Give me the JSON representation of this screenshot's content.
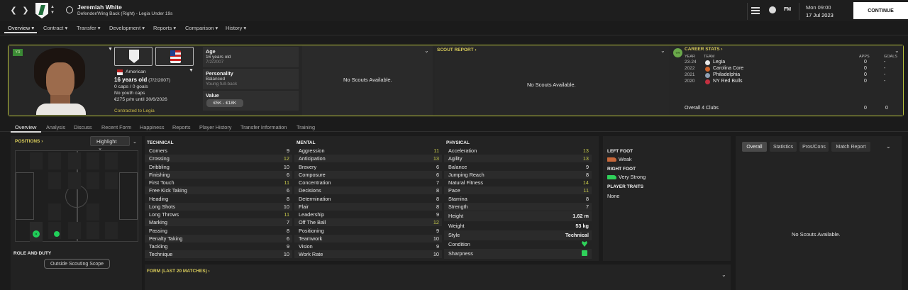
{
  "header": {
    "player_name": "Jeremiah White",
    "player_subtitle": "Defender/Wing Back (Right) - Legia Under 19s",
    "fm_logo": "FM",
    "date_day": "Mon 09:00",
    "date_full": "17 Jul 2023",
    "continue_label": "CONTINUE",
    "back_icon": "chevron-left-icon",
    "forward_icon": "chevron-right-icon"
  },
  "nav": {
    "items": [
      "Overview",
      "Contract",
      "Transfer",
      "Development",
      "Reports",
      "Comparison",
      "History"
    ]
  },
  "profile": {
    "badge": "YR",
    "nationality": "American",
    "age_line": "16 years old",
    "dob_short": "(7/2/2007)",
    "caps": "0 caps / 0 goals",
    "youth_caps": "No youth caps",
    "wage": "€275 p/m until 30/6/2026",
    "contract_status": "Contracted to Legia",
    "age_label": "Age",
    "age_value": "16 years old",
    "age_dob": "7/2/2007",
    "personality_label": "Personality",
    "personality_value": "Balanced",
    "personality_sub": "Young full-back",
    "value_label": "Value",
    "value_range": "€5K - €18K",
    "no_scouts_1": "No Scouts Available.",
    "scout_report_label": "SCOUT REPORT",
    "no_scouts_2": "No Scouts Available.",
    "career_badge": "YR",
    "career_label": "CAREER STATS",
    "career_headers": {
      "year": "YEAR",
      "team": "TEAM",
      "apps": "APPS",
      "goals": "GOALS"
    },
    "career_rows": [
      {
        "year": "23-24",
        "team": "Legia",
        "apps": "0",
        "goals": "-"
      },
      {
        "year": "2022",
        "team": "Carolina Core",
        "apps": "0",
        "goals": "-"
      },
      {
        "year": "2021",
        "team": "Philadelphia",
        "apps": "0",
        "goals": "-"
      },
      {
        "year": "2020",
        "team": "NY Red Bulls",
        "apps": "0",
        "goals": "-"
      }
    ],
    "career_total": {
      "label": "Overall 4 Clubs",
      "apps": "0",
      "goals": "0"
    }
  },
  "subtabs": [
    "Overview",
    "Analysis",
    "Discuss",
    "Recent Form",
    "Happiness",
    "Reports",
    "Player History",
    "Transfer Information",
    "Training"
  ],
  "positions": {
    "label": "POSITIONS",
    "highlight_label": "Highlight",
    "role_duty_label": "ROLE AND DUTY",
    "outside_scope": "Outside Scouting Scope"
  },
  "attributes": {
    "technical_label": "TECHNICAL",
    "mental_label": "MENTAL",
    "physical_label": "PHYSICAL",
    "technical": [
      {
        "name": "Corners",
        "value": "9",
        "tone": ""
      },
      {
        "name": "Crossing",
        "value": "12",
        "tone": "y"
      },
      {
        "name": "Dribbling",
        "value": "10",
        "tone": ""
      },
      {
        "name": "Finishing",
        "value": "6",
        "tone": ""
      },
      {
        "name": "First Touch",
        "value": "11",
        "tone": "y"
      },
      {
        "name": "Free Kick Taking",
        "value": "6",
        "tone": ""
      },
      {
        "name": "Heading",
        "value": "8",
        "tone": ""
      },
      {
        "name": "Long Shots",
        "value": "10",
        "tone": ""
      },
      {
        "name": "Long Throws",
        "value": "11",
        "tone": "y"
      },
      {
        "name": "Marking",
        "value": "7",
        "tone": ""
      },
      {
        "name": "Passing",
        "value": "8",
        "tone": ""
      },
      {
        "name": "Penalty Taking",
        "value": "6",
        "tone": ""
      },
      {
        "name": "Tackling",
        "value": "9",
        "tone": ""
      },
      {
        "name": "Technique",
        "value": "10",
        "tone": ""
      }
    ],
    "mental": [
      {
        "name": "Aggression",
        "value": "11",
        "tone": "y"
      },
      {
        "name": "Anticipation",
        "value": "13",
        "tone": "y"
      },
      {
        "name": "Bravery",
        "value": "6",
        "tone": ""
      },
      {
        "name": "Composure",
        "value": "6",
        "tone": ""
      },
      {
        "name": "Concentration",
        "value": "7",
        "tone": ""
      },
      {
        "name": "Decisions",
        "value": "8",
        "tone": ""
      },
      {
        "name": "Determination",
        "value": "8",
        "tone": ""
      },
      {
        "name": "Flair",
        "value": "8",
        "tone": ""
      },
      {
        "name": "Leadership",
        "value": "9",
        "tone": ""
      },
      {
        "name": "Off The Ball",
        "value": "12",
        "tone": "y"
      },
      {
        "name": "Positioning",
        "value": "9",
        "tone": ""
      },
      {
        "name": "Teamwork",
        "value": "10",
        "tone": ""
      },
      {
        "name": "Vision",
        "value": "9",
        "tone": ""
      },
      {
        "name": "Work Rate",
        "value": "10",
        "tone": ""
      }
    ],
    "physical": [
      {
        "name": "Acceleration",
        "value": "13",
        "tone": "y"
      },
      {
        "name": "Agility",
        "value": "13",
        "tone": "y"
      },
      {
        "name": "Balance",
        "value": "9",
        "tone": ""
      },
      {
        "name": "Jumping Reach",
        "value": "8",
        "tone": ""
      },
      {
        "name": "Natural Fitness",
        "value": "14",
        "tone": "y"
      },
      {
        "name": "Pace",
        "value": "11",
        "tone": "y"
      },
      {
        "name": "Stamina",
        "value": "8",
        "tone": ""
      },
      {
        "name": "Strength",
        "value": "7",
        "tone": ""
      }
    ],
    "height_label": "Height",
    "height_value": "1.62 m",
    "weight_label": "Weight",
    "weight_value": "53 kg",
    "style_label": "Style",
    "style_value": "Technical",
    "condition_label": "Condition",
    "sharpness_label": "Sharpness",
    "accent_yellow": "#c6c94a",
    "accent_green": "#2fd15a"
  },
  "form": {
    "label": "FORM (LAST 20 MATCHES)"
  },
  "feet": {
    "left_label": "LEFT FOOT",
    "left_value": "Weak",
    "left_color": "#c8683a",
    "right_label": "RIGHT FOOT",
    "right_value": "Very Strong",
    "right_color": "#2fd15a",
    "traits_label": "PLAYER TRAITS",
    "traits_value": "None"
  },
  "scout_panel": {
    "tabs": [
      "Overall",
      "Statistics",
      "Pros/Cons",
      "Match Report"
    ],
    "message": "No Scouts Available."
  }
}
